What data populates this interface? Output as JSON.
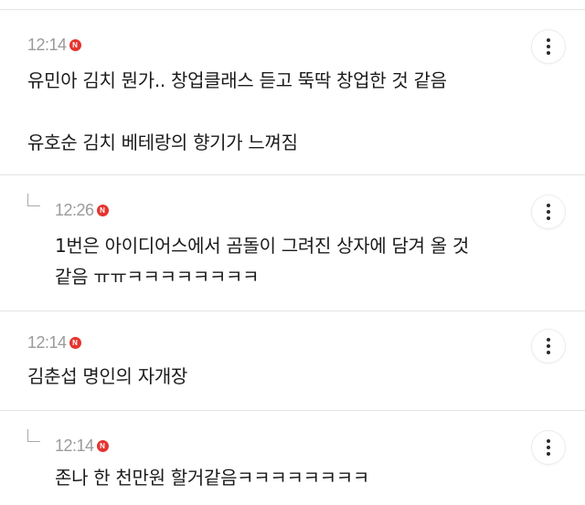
{
  "comments": [
    {
      "time": "12:14",
      "badge": "N",
      "lines": [
        "유민아 김치 뭔가.. 창업클래스 듣고 뚝딱 창업한 것 같음",
        "",
        "유호순 김치 베테랑의 향기가 느껴짐"
      ],
      "is_reply": false
    },
    {
      "time": "12:26",
      "badge": "N",
      "lines": [
        "1번은 아이디어스에서 곰돌이 그려진 상자에 담겨 올 것",
        "같음 ㅠㅠㅋㅋㅋㅋㅋㅋㅋㅋ"
      ],
      "is_reply": true
    },
    {
      "time": "12:14",
      "badge": "N",
      "lines": [
        "김춘섭 명인의 자개장"
      ],
      "is_reply": false
    },
    {
      "time": "12:14",
      "badge": "N",
      "lines": [
        "존나 한 천만원 할거같음ㅋㅋㅋㅋㅋㅋㅋㅋ"
      ],
      "is_reply": true
    }
  ],
  "icons": {
    "more": "more-vertical-icon",
    "new_badge": "new-badge-icon",
    "reply": "reply-arrow-icon"
  },
  "colors": {
    "badge": "#e3342f",
    "time": "#9b9b9b",
    "divider": "#e4e4e4"
  }
}
